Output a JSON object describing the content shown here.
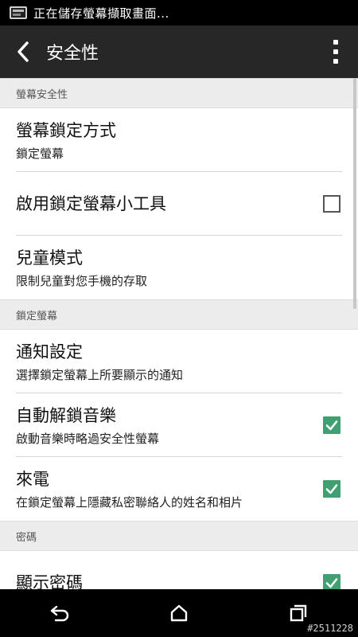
{
  "status_bar": {
    "notification": "正在儲存螢幕擷取畫面..."
  },
  "app_bar": {
    "title": "安全性"
  },
  "sections": [
    {
      "header": "螢幕安全性",
      "items": [
        {
          "title": "螢幕鎖定方式",
          "summary": "鎖定螢幕"
        },
        {
          "title": "啟用鎖定螢幕小工具",
          "checked": false
        },
        {
          "title": "兒童模式",
          "summary": "限制兒童對您手機的存取"
        }
      ]
    },
    {
      "header": "鎖定螢幕",
      "items": [
        {
          "title": "通知設定",
          "summary": "選擇鎖定螢幕上所要顯示的通知"
        },
        {
          "title": "自動解鎖音樂",
          "summary": "啟動音樂時略過安全性螢幕",
          "checked": true
        },
        {
          "title": "來電",
          "summary": "在鎖定螢幕上隱藏私密聯絡人的姓名和相片",
          "checked": true
        }
      ]
    },
    {
      "header": "密碼",
      "items": [
        {
          "title": "顯示密碼",
          "checked": true
        }
      ]
    }
  ],
  "colors": {
    "accent": "#3fa072",
    "appbar": "#272727",
    "section_bg": "#ececec"
  },
  "watermark": "#2511228"
}
